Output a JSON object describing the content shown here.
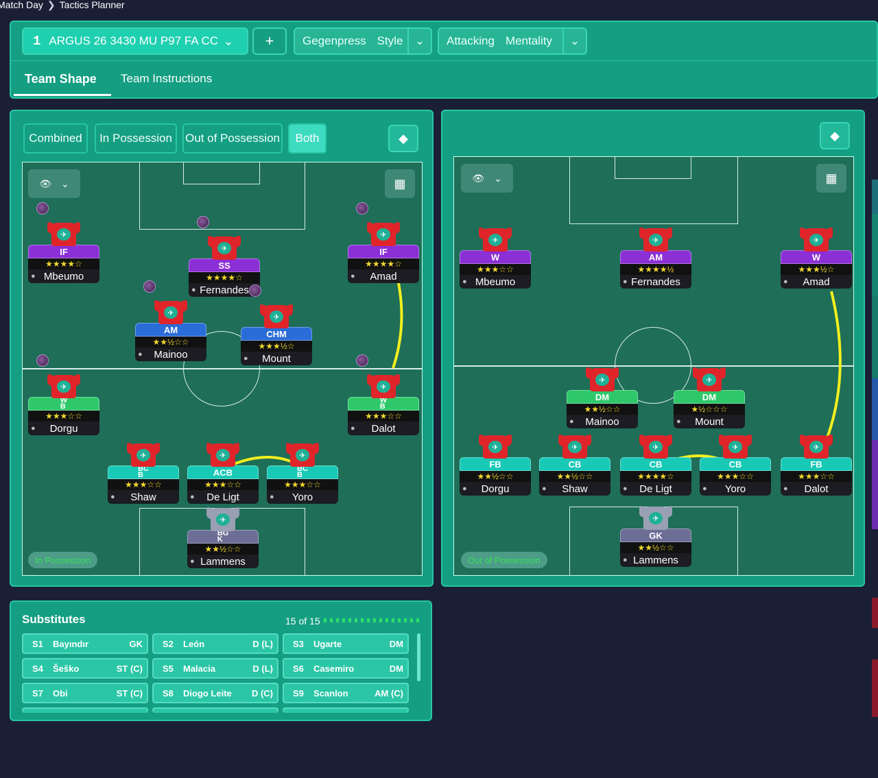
{
  "breadcrumbs": [
    "Match Day",
    "Tactics Planner"
  ],
  "tactic": {
    "number": "1",
    "name": "ARGUS 26 3430 MU P97 FA CC",
    "add": "+"
  },
  "style": {
    "value": "Gegenpress",
    "label": "Style"
  },
  "mentality": {
    "value": "Attacking",
    "label": "Mentality"
  },
  "tabs": [
    "Team Shape",
    "Team Instructions"
  ],
  "filters": [
    "Combined",
    "In Possession",
    "Out of Possession",
    "Both"
  ],
  "left_pitch_label": "In Possession",
  "right_pitch_label": "Out of Possession",
  "left_players": [
    {
      "role": "IF",
      "stars": "★★★★☆",
      "name": "Mbeumo",
      "color": "r-purple",
      "orb": true
    },
    {
      "role": "SS",
      "stars": "★★★★☆",
      "name": "Fernandes",
      "color": "r-purple",
      "orb": true
    },
    {
      "role": "IF",
      "stars": "★★★★☆",
      "name": "Amad",
      "color": "r-purple",
      "orb": true
    },
    {
      "role": "AM",
      "stars": "★★½☆☆",
      "name": "Mainoo",
      "color": "r-blue",
      "orb": true
    },
    {
      "role": "CHM",
      "stars": "★★★½☆",
      "name": "Mount",
      "color": "r-blue",
      "orb": true
    },
    {
      "role": "W\nB",
      "stars": "★★★☆☆",
      "name": "Dorgu",
      "color": "r-green",
      "orb": true
    },
    {
      "role": "W\nB",
      "stars": "★★★☆☆",
      "name": "Dalot",
      "color": "r-green",
      "orb": true
    },
    {
      "role": "BC\nB",
      "stars": "★★★☆☆",
      "name": "Shaw",
      "color": "r-teal"
    },
    {
      "role": "ACB",
      "stars": "★★★☆☆",
      "name": "De Ligt",
      "color": "r-teal"
    },
    {
      "role": "BC\nB",
      "stars": "★★★☆☆",
      "name": "Yoro",
      "color": "r-teal"
    },
    {
      "role": "BG\nK",
      "stars": "★★½☆☆",
      "name": "Lammens",
      "color": "r-gk",
      "gk": true
    }
  ],
  "right_players": [
    {
      "role": "W",
      "stars": "★★★☆☆",
      "name": "Mbeumo",
      "color": "r-purple"
    },
    {
      "role": "AM",
      "stars": "★★★★½",
      "name": "Fernandes",
      "color": "r-purple"
    },
    {
      "role": "W",
      "stars": "★★★½☆",
      "name": "Amad",
      "color": "r-purple"
    },
    {
      "role": "DM",
      "stars": "★★½☆☆",
      "name": "Mainoo",
      "color": "r-green"
    },
    {
      "role": "DM",
      "stars": "★½☆☆☆",
      "name": "Mount",
      "color": "r-green"
    },
    {
      "role": "FB",
      "stars": "★★½☆☆",
      "name": "Dorgu",
      "color": "r-teal"
    },
    {
      "role": "CB",
      "stars": "★★½☆☆",
      "name": "Shaw",
      "color": "r-teal"
    },
    {
      "role": "CB",
      "stars": "★★★★☆",
      "name": "De Ligt",
      "color": "r-teal"
    },
    {
      "role": "CB",
      "stars": "★★★☆☆",
      "name": "Yoro",
      "color": "r-teal"
    },
    {
      "role": "FB",
      "stars": "★★★☆☆",
      "name": "Dalot",
      "color": "r-teal"
    },
    {
      "role": "GK",
      "stars": "★★½☆☆",
      "name": "Lammens",
      "color": "r-gk",
      "gk": true
    }
  ],
  "substitutes": {
    "title": "Substitutes",
    "count": "15 of 15",
    "items": [
      {
        "n": "S1",
        "name": "Bayındır",
        "pos": "GK"
      },
      {
        "n": "S2",
        "name": "León",
        "pos": "D (L)"
      },
      {
        "n": "S3",
        "name": "Ugarte",
        "pos": "DM"
      },
      {
        "n": "S4",
        "name": "Šeško",
        "pos": "ST (C)"
      },
      {
        "n": "S5",
        "name": "Malacia",
        "pos": "D (L)"
      },
      {
        "n": "S6",
        "name": "Casemiro",
        "pos": "DM"
      },
      {
        "n": "S7",
        "name": "Obi",
        "pos": "ST (C)"
      },
      {
        "n": "S8",
        "name": "Diogo Leite",
        "pos": "D (C)"
      },
      {
        "n": "S9",
        "name": "Scanlon",
        "pos": "AM (C)"
      }
    ]
  },
  "icons": {
    "dropdown": "chevron-down-icon",
    "eye": "eye-icon",
    "grid": "grid-icon",
    "diamond": "diamond-icon",
    "player": "person-icon"
  },
  "colors": {
    "accent": "#1fd0b0",
    "panel": "#149e82",
    "pitch": "#1e6e58",
    "link_line": "#f2ef1e"
  }
}
